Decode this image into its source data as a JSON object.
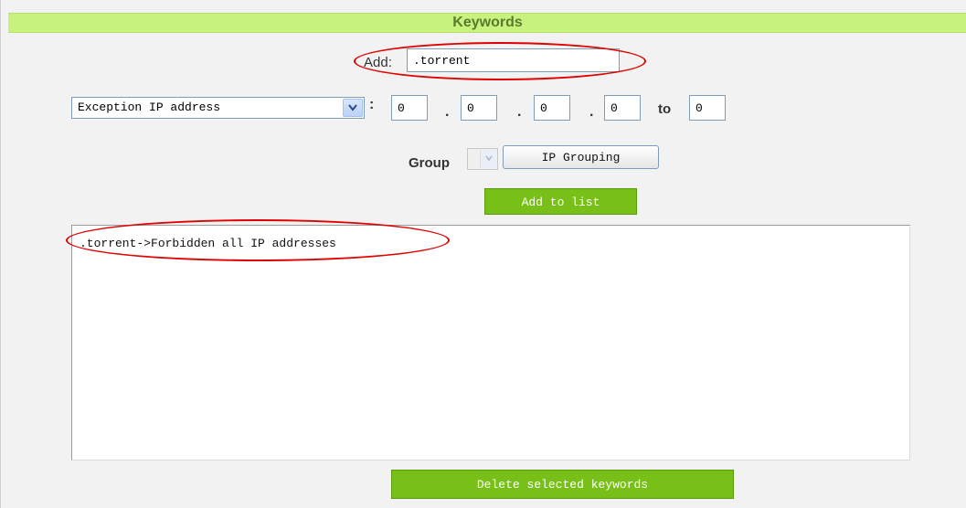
{
  "panel": {
    "title": "Keywords"
  },
  "add": {
    "label": "Add:",
    "value": ".torrent"
  },
  "ip_range": {
    "type_selected": "Exception IP address",
    "octets": [
      "0",
      "0",
      "0",
      "0"
    ],
    "separator_colon": ":",
    "dot": ".",
    "to_label": "to",
    "to_value": "0"
  },
  "group": {
    "label": "Group",
    "selected": "",
    "ip_grouping_label": "IP Grouping"
  },
  "buttons": {
    "add_to_list": "Add to list",
    "delete_selected": "Delete selected keywords"
  },
  "keyword_list": {
    "items": [
      ".torrent->Forbidden all IP addresses"
    ]
  },
  "colors": {
    "title_bar": "#c7f27d",
    "title_text": "#5c7a2e",
    "button_green": "#78c018",
    "highlight_red": "#e00000"
  },
  "icons": {
    "dropdown": "chevron-down-icon"
  }
}
